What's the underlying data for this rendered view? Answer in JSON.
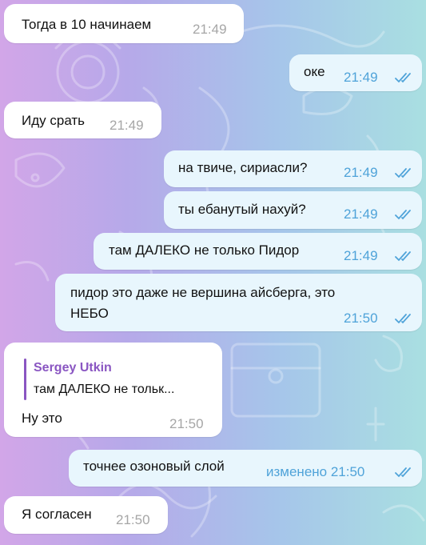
{
  "messages": [
    {
      "id": "m1",
      "dir": "in",
      "text": "Тогда в 10 начинаем",
      "time": "21:49"
    },
    {
      "id": "m2",
      "dir": "out",
      "text": "оке",
      "time": "21:49",
      "status": "read-double-check-icon"
    },
    {
      "id": "m3",
      "dir": "in",
      "text": "Иду срать",
      "time": "21:49"
    },
    {
      "id": "m4",
      "dir": "out",
      "text": "на твиче, сириасли?",
      "time": "21:49",
      "status": "read-double-check-icon"
    },
    {
      "id": "m5",
      "dir": "out",
      "text": "ты ебанутый нахуй?",
      "time": "21:49",
      "status": "read-double-check-icon"
    },
    {
      "id": "m6",
      "dir": "out",
      "text": "там ДАЛЕКО не только Пидор",
      "time": "21:49",
      "status": "read-double-check-icon"
    },
    {
      "id": "m7",
      "dir": "out",
      "lines": [
        "пидор это даже не вершина айсберга, это",
        "НЕБО"
      ],
      "time": "21:50",
      "status": "read-double-check-icon"
    },
    {
      "id": "m8",
      "dir": "in",
      "reply": {
        "name": "Sergey Utkin",
        "text": "там ДАЛЕКО не тольк..."
      },
      "text": "Ну это",
      "time": "21:50"
    },
    {
      "id": "m9",
      "dir": "out",
      "text": "точнее озоновый слой",
      "time": "изменено 21:50",
      "status": "read-double-check-icon"
    },
    {
      "id": "m10",
      "dir": "in",
      "text": "Я согласен",
      "time": "21:50"
    }
  ],
  "colors": {
    "incoming_bubble": "#ffffff",
    "outgoing_bubble": "#e8f6fd",
    "outgoing_meta": "#4fa3d9",
    "incoming_meta": "#a6a6a6",
    "reply_accent": "#8a56c2"
  }
}
